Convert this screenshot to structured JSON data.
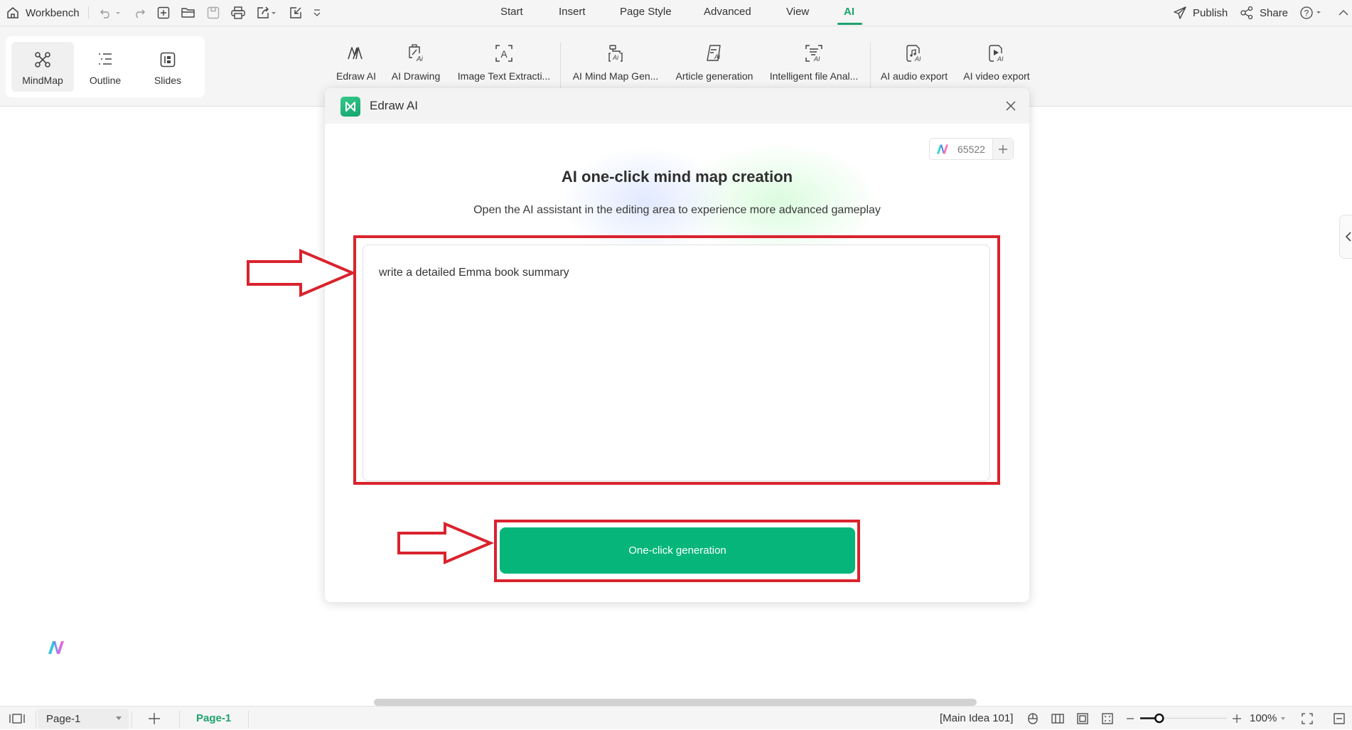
{
  "topbar": {
    "workbench_label": "Workbench",
    "menu_tabs": [
      {
        "label": "Start",
        "active": false
      },
      {
        "label": "Insert",
        "active": false
      },
      {
        "label": "Page Style",
        "active": false
      },
      {
        "label": "Advanced",
        "active": false
      },
      {
        "label": "View",
        "active": false
      },
      {
        "label": "AI",
        "active": true
      }
    ],
    "publish_label": "Publish",
    "share_label": "Share",
    "quick_icons": [
      "home-icon",
      "undo-icon",
      "redo-icon",
      "new-file-icon",
      "open-folder-icon",
      "save-icon",
      "print-icon",
      "export-icon",
      "check-export-icon",
      "more-icon",
      "help-icon",
      "collapse-icon"
    ]
  },
  "view_switch": {
    "items": [
      {
        "label": "MindMap",
        "icon": "mindmap-icon",
        "active": true
      },
      {
        "label": "Outline",
        "icon": "outline-icon",
        "active": false
      },
      {
        "label": "Slides",
        "icon": "slides-icon",
        "active": false
      }
    ]
  },
  "ribbon": {
    "items": [
      {
        "label": "Edraw AI",
        "icon": "edraw-ai-icon"
      },
      {
        "label": "AI Drawing",
        "icon": "ai-drawing-icon"
      },
      {
        "label": "Image Text Extracti...",
        "icon": "image-text-extraction-icon"
      },
      {
        "label": "AI Mind Map Gen...",
        "icon": "ai-mindmap-gen-icon"
      },
      {
        "label": "Article generation",
        "icon": "article-generation-icon"
      },
      {
        "label": "Intelligent file Anal...",
        "icon": "file-analysis-icon"
      },
      {
        "label": "AI audio export",
        "icon": "audio-export-icon"
      },
      {
        "label": "AI video export",
        "icon": "video-export-icon"
      }
    ]
  },
  "dialog": {
    "title": "Edraw AI",
    "credits": "65522",
    "heading": "AI one-click mind map creation",
    "subheading": "Open the AI assistant in the editing area to experience more advanced gameplay",
    "prompt_value": "write a detailed Emma book summary",
    "generate_label": "One-click generation",
    "accent_color": "#05b57a"
  },
  "annotations": {
    "highlight_color": "#d9232d"
  },
  "statusbar": {
    "page_select_value": "Page-1",
    "active_page_tab": "Page-1",
    "selection_info": "[Main Idea 101]",
    "zoom_level": "100%",
    "zoom_fraction": 0.22
  }
}
